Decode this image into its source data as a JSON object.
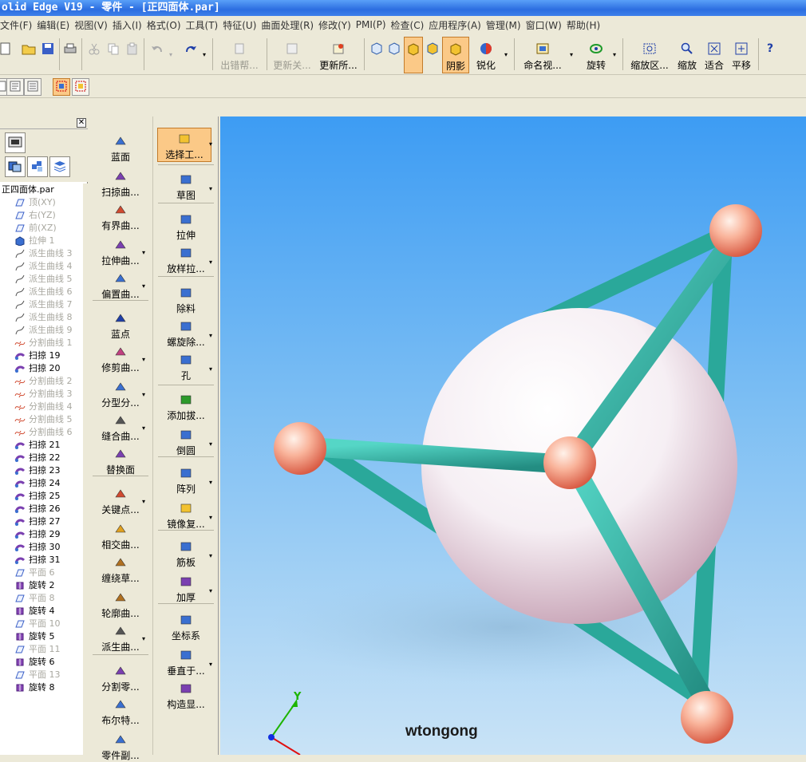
{
  "window": {
    "title": "olid Edge V19 - 零件 - [正四面体.par]"
  },
  "menu": [
    "文件(F)",
    "编辑(E)",
    "视图(V)",
    "插入(I)",
    "格式(O)",
    "工具(T)",
    "特征(U)",
    "曲面处理(R)",
    "修改(Y)",
    "PMI(P)",
    "检查(C)",
    "应用程序(A)",
    "管理(M)",
    "窗口(W)",
    "帮助(H)"
  ],
  "toolbar": {
    "error_help": "出错帮...",
    "update_rel": "更新关...",
    "update_all": "更新所...",
    "shading": "阴影",
    "sharpen": "锐化",
    "named_view": "命名视...",
    "rotate": "旋转",
    "zoom_area": "缩放区...",
    "zoom": "缩放",
    "fit": "适合",
    "pan": "平移",
    "help_glyph": "?"
  },
  "pathfinder": {
    "root": "正四面体.par",
    "items": [
      {
        "label": "顶(XY)",
        "dim": true,
        "icon": "plane-icon"
      },
      {
        "label": "右(YZ)",
        "dim": true,
        "icon": "plane-icon"
      },
      {
        "label": "前(XZ)",
        "dim": true,
        "icon": "plane-icon"
      },
      {
        "label": "拉伸 1",
        "dim": true,
        "icon": "extrude-icon"
      },
      {
        "label": "派生曲线 3",
        "dim": true,
        "icon": "curve-icon"
      },
      {
        "label": "派生曲线 4",
        "dim": true,
        "icon": "curve-icon"
      },
      {
        "label": "派生曲线 5",
        "dim": true,
        "icon": "curve-icon"
      },
      {
        "label": "派生曲线 6",
        "dim": true,
        "icon": "curve-icon"
      },
      {
        "label": "派生曲线 7",
        "dim": true,
        "icon": "curve-icon"
      },
      {
        "label": "派生曲线 8",
        "dim": true,
        "icon": "curve-icon"
      },
      {
        "label": "派生曲线 9",
        "dim": true,
        "icon": "curve-icon"
      },
      {
        "label": "分割曲线 1",
        "dim": true,
        "icon": "split-curve-icon"
      },
      {
        "label": "扫掠 19",
        "dim": false,
        "icon": "sweep-icon"
      },
      {
        "label": "扫掠 20",
        "dim": false,
        "icon": "sweep-icon"
      },
      {
        "label": "分割曲线 2",
        "dim": true,
        "icon": "split-curve-icon"
      },
      {
        "label": "分割曲线 3",
        "dim": true,
        "icon": "split-curve-icon"
      },
      {
        "label": "分割曲线 4",
        "dim": true,
        "icon": "split-curve-icon"
      },
      {
        "label": "分割曲线 5",
        "dim": true,
        "icon": "split-curve-icon"
      },
      {
        "label": "分割曲线 6",
        "dim": true,
        "icon": "split-curve-icon"
      },
      {
        "label": "扫掠 21",
        "dim": false,
        "icon": "sweep-icon"
      },
      {
        "label": "扫掠 22",
        "dim": false,
        "icon": "sweep-icon"
      },
      {
        "label": "扫掠 23",
        "dim": false,
        "icon": "sweep-icon"
      },
      {
        "label": "扫掠 24",
        "dim": false,
        "icon": "sweep-icon"
      },
      {
        "label": "扫掠 25",
        "dim": false,
        "icon": "sweep-icon"
      },
      {
        "label": "扫掠 26",
        "dim": false,
        "icon": "sweep-icon"
      },
      {
        "label": "扫掠 27",
        "dim": false,
        "icon": "sweep-icon"
      },
      {
        "label": "扫掠 29",
        "dim": false,
        "icon": "sweep-icon"
      },
      {
        "label": "扫掠 30",
        "dim": false,
        "icon": "sweep-icon"
      },
      {
        "label": "扫掠 31",
        "dim": false,
        "icon": "sweep-icon"
      },
      {
        "label": "平面 6",
        "dim": true,
        "icon": "plane-icon"
      },
      {
        "label": "旋转 2",
        "dim": false,
        "icon": "revolve-icon"
      },
      {
        "label": "平面 8",
        "dim": true,
        "icon": "plane-icon"
      },
      {
        "label": "旋转 4",
        "dim": false,
        "icon": "revolve-icon"
      },
      {
        "label": "平面 10",
        "dim": true,
        "icon": "plane-icon"
      },
      {
        "label": "旋转 5",
        "dim": false,
        "icon": "revolve-icon"
      },
      {
        "label": "平面 11",
        "dim": true,
        "icon": "plane-icon"
      },
      {
        "label": "旋转 6",
        "dim": false,
        "icon": "revolve-icon"
      },
      {
        "label": "平面 13",
        "dim": true,
        "icon": "plane-icon"
      },
      {
        "label": "旋转 8",
        "dim": false,
        "icon": "revolve-icon"
      }
    ]
  },
  "surface_cmds": [
    "蓝面",
    "扫掠曲...",
    "有界曲...",
    "拉伸曲...",
    "偏置曲...",
    "蓝点",
    "修剪曲...",
    "分型分...",
    "缝合曲...",
    "替换面",
    "关键点...",
    "相交曲...",
    "缠绕草...",
    "轮廓曲...",
    "派生曲...",
    "分割零...",
    "布尔特...",
    "零件副..."
  ],
  "feature_cmds": [
    "选择工...",
    "草图",
    "拉伸",
    "放样拉...",
    "除料",
    "螺旋除...",
    "孔",
    "添加拔...",
    "倒圆",
    "阵列",
    "镜像复...",
    "筋板",
    "加厚",
    "坐标系",
    "垂直于...",
    "构造显..."
  ],
  "viewport": {
    "watermark": "wtongong",
    "axis_y": "Y"
  },
  "colors": {
    "title_bar": "#2c6ee0",
    "chrome": "#ece9d8",
    "active_button": "#fbc987",
    "tube": "#2fb5a5",
    "node": "#f4a48a",
    "sphere": "#f5eef3",
    "viewport_top": "#3d9cf3",
    "viewport_bottom": "#c9e3f6"
  }
}
